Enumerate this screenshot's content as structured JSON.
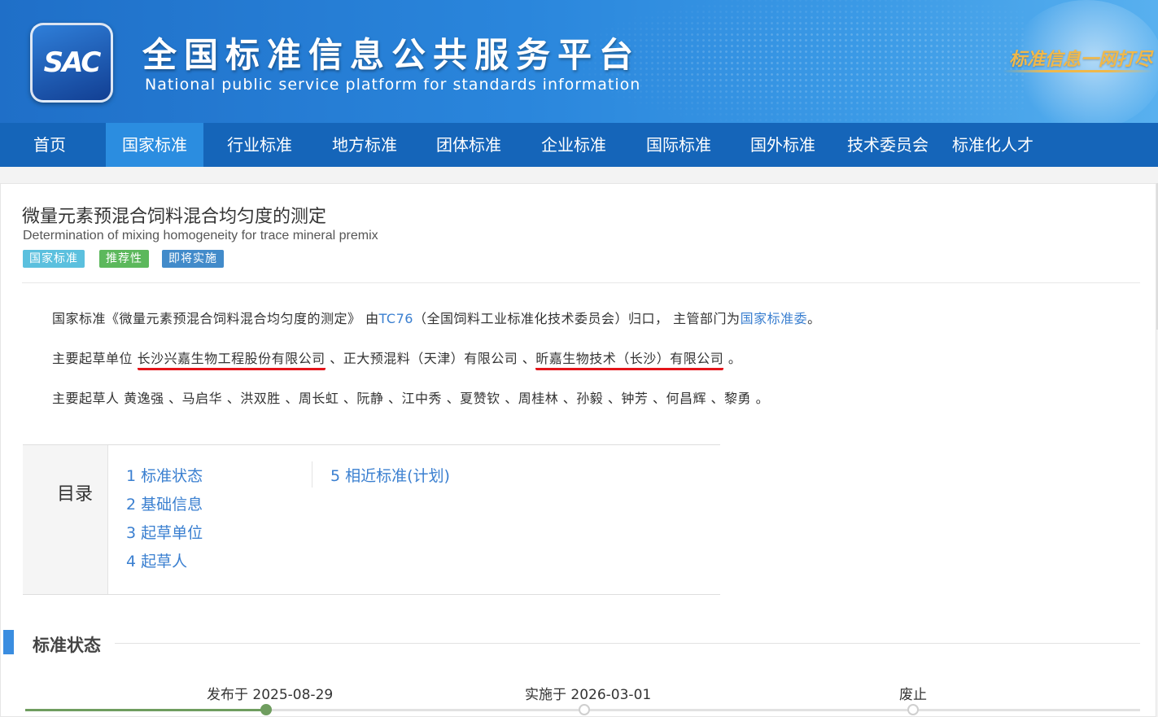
{
  "header": {
    "logo_text": "SAC",
    "title": "全国标准信息公共服务平台",
    "subtitle": "National public service platform  for standards information",
    "slogan": "标准信息一网打尽"
  },
  "nav": {
    "items": [
      {
        "label": "首页",
        "active": false
      },
      {
        "label": "国家标准",
        "active": true
      },
      {
        "label": "行业标准",
        "active": false
      },
      {
        "label": "地方标准",
        "active": false
      },
      {
        "label": "团体标准",
        "active": false
      },
      {
        "label": "企业标准",
        "active": false
      },
      {
        "label": "国际标准",
        "active": false
      },
      {
        "label": "国外标准",
        "active": false
      },
      {
        "label": "技术委员会",
        "active": false
      },
      {
        "label": "标准化人才",
        "active": false
      }
    ]
  },
  "standard": {
    "title_cn": "微量元素预混合饲料混合均匀度的测定",
    "title_en": "Determination of mixing homogeneity for trace mineral premix",
    "badges": [
      {
        "label": "国家标准",
        "color": "#5bc0de"
      },
      {
        "label": "推荐性",
        "color": "#5cb85c"
      },
      {
        "label": "即将实施",
        "color": "#428bca"
      }
    ]
  },
  "summary": {
    "line1_prefix": "国家标准《微量元素预混合饲料混合均匀度的测定》 由",
    "line1_tc": "TC76",
    "line1_middle": "（全国饲料工业标准化技术委员会）归口， 主管部门为",
    "line1_dept": "国家标准委",
    "line1_suffix": "。",
    "line2_prefix": "主要起草单位 ",
    "line2_unit1": "长沙兴嘉生物工程股份有限公司",
    "line2_sep1": " 、正大预混料（天津）有限公司 、",
    "line2_unit3": "昕嘉生物技术（长沙）有限公司",
    "line2_suffix": " 。",
    "line3": "主要起草人 黄逸强 、马启华 、洪双胜 、周长虹 、阮静 、江中秀 、夏赞钦 、周桂林 、孙毅 、钟芳 、何昌辉 、黎勇 。"
  },
  "toc": {
    "label": "目录",
    "items": [
      {
        "num": "1",
        "label": "标准状态"
      },
      {
        "num": "2",
        "label": "基础信息"
      },
      {
        "num": "3",
        "label": "起草单位"
      },
      {
        "num": "4",
        "label": "起草人"
      },
      {
        "num": "5",
        "label": "相近标准(计划)"
      }
    ]
  },
  "status_section": {
    "title": "标准状态",
    "timeline": [
      {
        "label": "发布于 2025-08-29",
        "done": true
      },
      {
        "label": "实施于 2026-03-01",
        "done": false
      },
      {
        "label": "废止",
        "done": false
      }
    ],
    "progress": 0.22
  },
  "colors": {
    "nav_bg": "#1565b9",
    "nav_active": "#2b8de0",
    "link": "#3a7fd0",
    "underline_mark": "#e3151b",
    "timeline_done": "#6f9d5f"
  }
}
